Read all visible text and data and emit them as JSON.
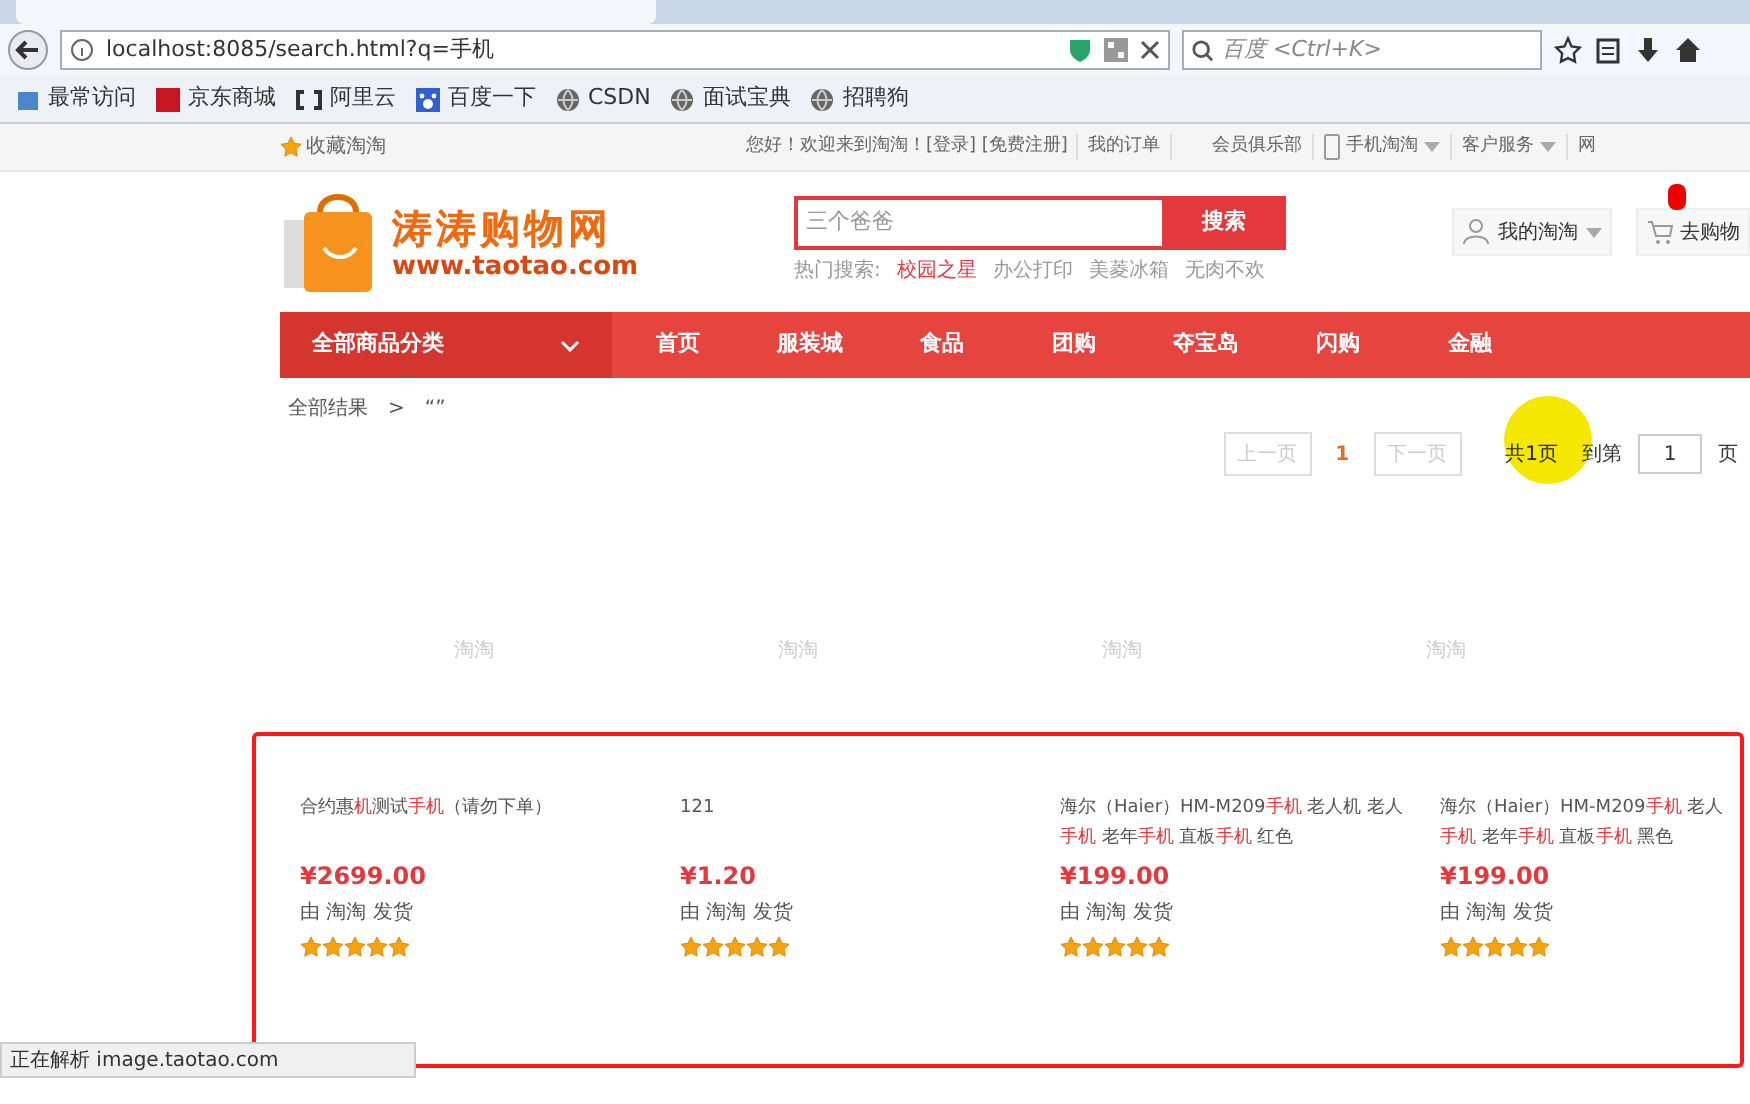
{
  "browser": {
    "url": "localhost:8085/search.html?q=手机",
    "search_placeholder": "百度 <Ctrl+K>",
    "bookmarks": [
      {
        "label": "最常访问",
        "kind": "folder"
      },
      {
        "label": "京东商城",
        "kind": "jd"
      },
      {
        "label": "阿里云",
        "kind": "aliyun"
      },
      {
        "label": "百度一下",
        "kind": "baidu"
      },
      {
        "label": "CSDN",
        "kind": "globe"
      },
      {
        "label": "面试宝典",
        "kind": "globe"
      },
      {
        "label": "招聘狗",
        "kind": "globe"
      }
    ],
    "status": "正在解析 image.taotao.com"
  },
  "topbar": {
    "favorite": "收藏淘淘",
    "welcome": "您好！欢迎来到淘淘！[登录] [免费注册]",
    "links": [
      {
        "label": "我的订单",
        "kind": "plain"
      },
      {
        "label": "会员俱乐部",
        "kind": "plain"
      },
      {
        "label": "手机淘淘",
        "kind": "phone"
      },
      {
        "label": "客户服务",
        "kind": "caret"
      },
      {
        "label": "网",
        "kind": "plain"
      }
    ]
  },
  "header": {
    "logo_title": "涛涛购物网",
    "logo_url": "www.taotao.com",
    "search_placeholder": "三个爸爸",
    "search_button": "搜索",
    "hot_label": "热门搜索:",
    "hot": [
      {
        "label": "校园之星",
        "highlight": true
      },
      {
        "label": "办公打印",
        "highlight": false
      },
      {
        "label": "美菱冰箱",
        "highlight": false
      },
      {
        "label": "无肉不欢",
        "highlight": false
      }
    ],
    "my_account": "我的淘淘",
    "cart": "去购物"
  },
  "nav": {
    "category": "全部商品分类",
    "items": [
      "首页",
      "服装城",
      "食品",
      "团购",
      "夺宝岛",
      "闪购",
      "金融"
    ]
  },
  "breadcrumb": {
    "root": "全部结果",
    "separator": ">",
    "query": "“”"
  },
  "pager": {
    "prev": "上一页",
    "pages": [
      {
        "label": "1",
        "selected": true
      }
    ],
    "next": "下一页",
    "total": "共1页",
    "goto": "到第",
    "page_value": "1",
    "unit": "页"
  },
  "image_alts": [
    "淘淘",
    "淘淘",
    "淘淘",
    "淘淘"
  ],
  "products": [
    {
      "title": [
        [
          {
            "t": "合约惠",
            "hl": false
          },
          {
            "t": "机",
            "hl": true
          },
          {
            "t": "测试",
            "hl": false
          },
          {
            "t": "手机",
            "hl": true
          },
          {
            "t": "（请勿下单）",
            "hl": false
          }
        ]
      ],
      "price": "¥2699.00",
      "seller": "由 淘淘 发货",
      "stars": 5
    },
    {
      "title": [
        [
          {
            "t": "121",
            "hl": false
          }
        ]
      ],
      "price": "¥1.20",
      "seller": "由 淘淘 发货",
      "stars": 5
    },
    {
      "title": [
        [
          {
            "t": "海尔（Haier）HM-M209",
            "hl": false
          },
          {
            "t": "手机",
            "hl": true
          },
          {
            "t": " 老人机 老人",
            "hl": false
          }
        ],
        [
          {
            "t": "手机",
            "hl": true
          },
          {
            "t": " 老年",
            "hl": false
          },
          {
            "t": "手机",
            "hl": true
          },
          {
            "t": " 直板",
            "hl": false
          },
          {
            "t": "手机",
            "hl": true
          },
          {
            "t": " 红色",
            "hl": false
          }
        ]
      ],
      "price": "¥199.00",
      "seller": "由 淘淘 发货",
      "stars": 5
    },
    {
      "title": [
        [
          {
            "t": "海尔（Haier）HM-M209",
            "hl": false
          },
          {
            "t": "手机",
            "hl": true
          },
          {
            "t": " 老人",
            "hl": false
          }
        ],
        [
          {
            "t": "手机",
            "hl": true
          },
          {
            "t": " 老年",
            "hl": false
          },
          {
            "t": "手机",
            "hl": true
          },
          {
            "t": " 直板",
            "hl": false
          },
          {
            "t": "手机",
            "hl": true
          },
          {
            "t": " 黑色",
            "hl": false
          }
        ]
      ],
      "price": "¥199.00",
      "seller": "由 淘淘 发货",
      "stars": 5
    }
  ]
}
